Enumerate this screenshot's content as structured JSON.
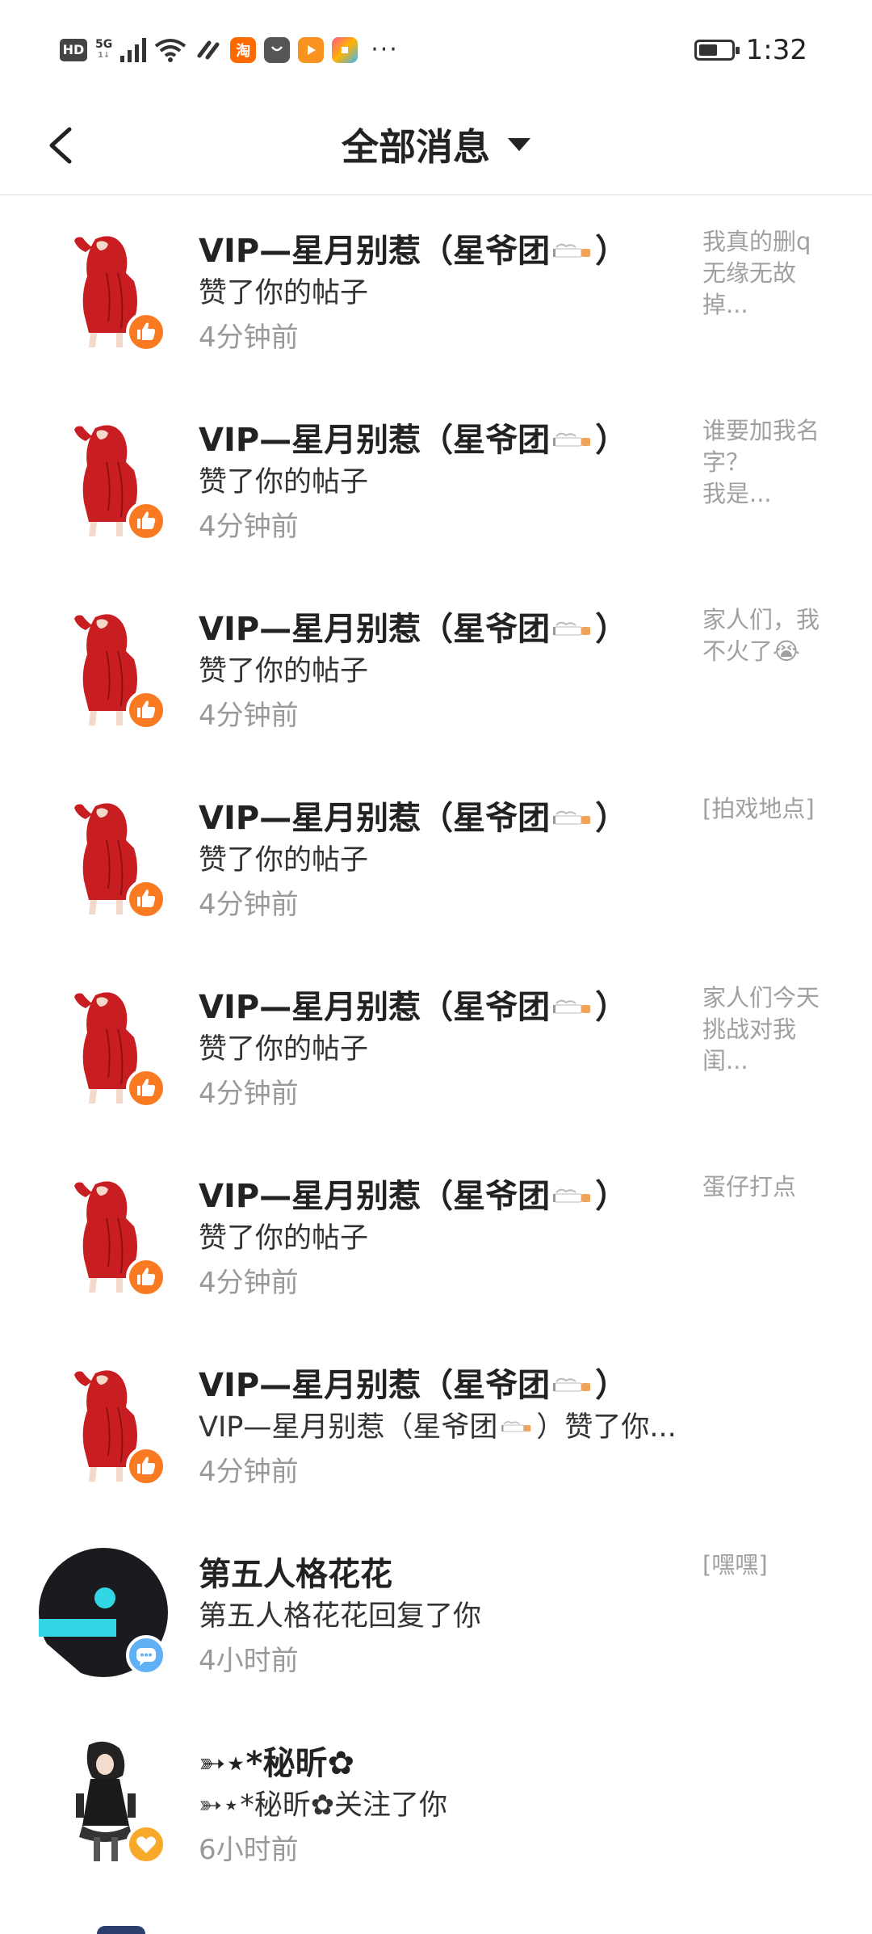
{
  "status_bar": {
    "hd": "HD",
    "net_top": "5G",
    "net_bottom": "1↓",
    "taobao": "淘",
    "dots": "···",
    "time": "1:32"
  },
  "header": {
    "title": "全部消息"
  },
  "colors": {
    "like": "#f97a20",
    "reply": "#5fb0f5",
    "follow": "#f8a92a"
  },
  "messages": [
    {
      "name_pre": "VIP—星月别惹（星爷团",
      "name_post": "）",
      "action": "赞了你的帖子",
      "time": "4分钟前",
      "preview": "我真的删q\n无缘无故\n掉...",
      "badge": "like-icon"
    },
    {
      "name_pre": "VIP—星月别惹（星爷团",
      "name_post": "）",
      "action": "赞了你的帖子",
      "time": "4分钟前",
      "preview": "谁要加我名\n字？\n我是...",
      "badge": "like-icon"
    },
    {
      "name_pre": "VIP—星月别惹（星爷团",
      "name_post": "）",
      "action": "赞了你的帖子",
      "time": "4分钟前",
      "preview": "家人们，我\n不火了😭",
      "badge": "like-icon"
    },
    {
      "name_pre": "VIP—星月别惹（星爷团",
      "name_post": "）",
      "action": "赞了你的帖子",
      "time": "4分钟前",
      "preview": "[拍戏地点]",
      "badge": "like-icon"
    },
    {
      "name_pre": "VIP—星月别惹（星爷团",
      "name_post": "）",
      "action": "赞了你的帖子",
      "time": "4分钟前",
      "preview": "家人们今天\n挑战对我\n闺...",
      "badge": "like-icon"
    },
    {
      "name_pre": "VIP—星月别惹（星爷团",
      "name_post": "）",
      "action": "赞了你的帖子",
      "time": "4分钟前",
      "preview": "蛋仔打点",
      "badge": "like-icon"
    },
    {
      "name_pre": "VIP—星月别惹（星爷团",
      "name_post": "）",
      "action_pre": "VIP—星月别惹（星爷团",
      "action_post": "）赞了你...",
      "time": "4分钟前",
      "preview": "",
      "badge": "like-icon"
    },
    {
      "name": "第五人格花花",
      "action": "第五人格花花回复了你",
      "time": "4小时前",
      "preview": "[嘿嘿]",
      "badge": "reply-icon"
    },
    {
      "name": "➳⋆*秘昕✿",
      "action": "➳⋆*秘昕✿关注了你",
      "time": "6小时前",
      "preview": "",
      "badge": "follow-icon"
    }
  ]
}
